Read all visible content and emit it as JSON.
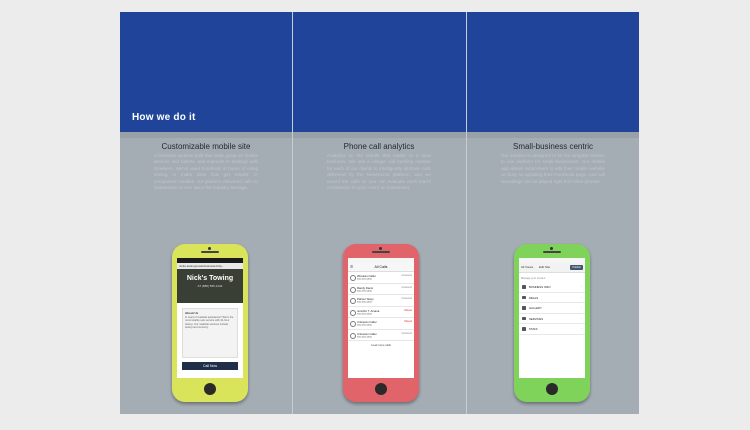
{
  "section_title": "How we do it",
  "columns": [
    {
      "title": "Customizable mobile site",
      "body": "A business website built that looks great on mobile devices and tablets, and expands to desktop web browsers. We've used hundreds of hours of using testing to make sites that get results. In comparison studies, our platform delivered calls to businesses at over twice the industry average."
    },
    {
      "title": "Phone call analytics",
      "body": "Analytics on the results that matter to a local business. We use a unique call tracking number for each of our clients to intelligently attribute calls delivered by the NewHound platform, and we record the calls so you can evaluate each lead's contribution to your return on investment."
    },
    {
      "title": "Small-business centric",
      "body": "Our solution is designed to be the simplest answer to use platform for small businesses. Our mobile app allows subscribers to edit their mobile website on busy us updating their Facebook page. And call recordings can be played right from their phones."
    }
  ],
  "phone1": {
    "url": "nicks-towing-local-business-http...",
    "hero_title": "Nick's Towing",
    "hero_sub": "AT (888) 555-1234",
    "card_heading": "About Us",
    "card_body": "In need of roadside assistance? We're the most reliable auto service with 24-hour towing. Our roadside services include towing and recovery.",
    "cta": "Call Now"
  },
  "phone2": {
    "nav_title": "All Calls",
    "menu_icon": "☰",
    "calls": [
      {
        "name": "Wireless Caller",
        "phone": "555-555-5555",
        "status": "Answered"
      },
      {
        "name": "Randy Davis",
        "phone": "555-555-5555",
        "status": "Answered"
      },
      {
        "name": "Palmer Stacy",
        "phone": "555-555-5555",
        "status": "Answered"
      },
      {
        "name": "Jennifer T. Amana",
        "phone": "555-555-5555",
        "status": "Missed"
      },
      {
        "name": "Unknown Caller",
        "phone": "555-555-5555",
        "status": "Missed"
      },
      {
        "name": "Unknown Caller",
        "phone": "555-555-5555",
        "status": "Answered"
      }
    ],
    "footer": "Load more calls"
  },
  "phone3": {
    "nav_left": "All Views",
    "nav_mid": "Edit Site",
    "nav_button": "Publish",
    "heading": "Manage your content",
    "items": [
      {
        "label": "BUSINESS INFO"
      },
      {
        "label": "DEALS"
      },
      {
        "label": "GALLERY"
      },
      {
        "label": "SERVICES"
      },
      {
        "label": "STAFF"
      }
    ],
    "chevron": "›"
  }
}
